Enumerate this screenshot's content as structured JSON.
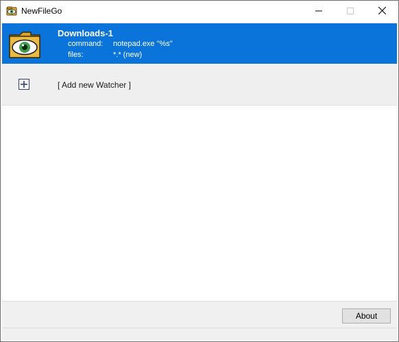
{
  "window": {
    "title": "NewFileGo",
    "app_icon": "eye-folder-icon",
    "controls": {
      "minimize": "minimize-icon",
      "maximize": "maximize-icon",
      "close": "close-icon"
    }
  },
  "watchers": [
    {
      "name": "Downloads-1",
      "icon": "eye-folder-icon",
      "command_label": "command:",
      "command_value": "notepad.exe \"%s\"",
      "files_label": "files:",
      "files_value": "*.* (new)",
      "selected": true
    }
  ],
  "add_watcher": {
    "label": "[ Add new Watcher ]",
    "icon": "plus-box-icon"
  },
  "footer": {
    "about_label": "About"
  },
  "colors": {
    "selection": "#0a74da",
    "add_row_bg": "#efefef",
    "footer_bg": "#f0f0f0"
  }
}
